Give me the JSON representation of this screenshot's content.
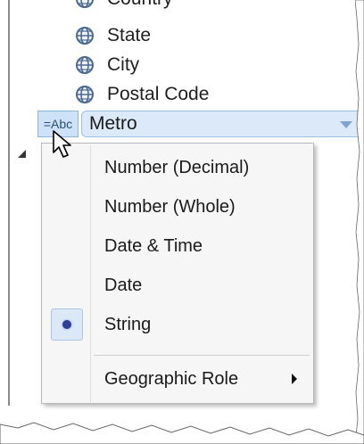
{
  "fields": [
    {
      "label": "Country",
      "icon": "globe-icon"
    },
    {
      "label": "State",
      "icon": "globe-icon"
    },
    {
      "label": "City",
      "icon": "globe-icon"
    },
    {
      "label": "Postal Code",
      "icon": "globe-icon"
    }
  ],
  "selected_field": {
    "type_icon_text": "=Abc",
    "label": "Metro"
  },
  "menu": {
    "items": [
      {
        "label": "Number (Decimal)"
      },
      {
        "label": "Number (Whole)"
      },
      {
        "label": "Date & Time"
      },
      {
        "label": "Date"
      },
      {
        "label": "String",
        "checked": true
      }
    ],
    "submenu": {
      "label": "Geographic Role"
    }
  },
  "colors": {
    "selection_fill": "#dbe9f8",
    "selection_border": "#9cbfe3",
    "radio_dot": "#2c3d9a"
  }
}
